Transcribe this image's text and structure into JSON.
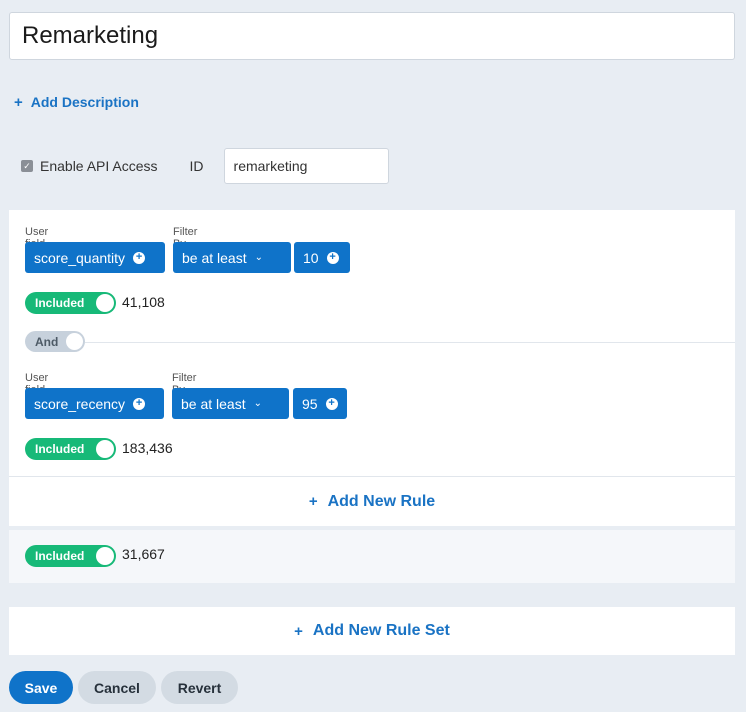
{
  "segment": {
    "name": "Remarketing"
  },
  "add_description": {
    "icon": "plus-icon",
    "label": "Add Description"
  },
  "api": {
    "checkbox_checked": true,
    "label": "Enable API Access",
    "id_label": "ID",
    "id_value": "remarketing"
  },
  "ruleset": {
    "rules": [
      {
        "user_field_label": "User field",
        "filter_label": "Filter By",
        "field": "score_quantity",
        "operator": "be at least",
        "value": "10",
        "toggle_label": "Included",
        "count": "41,108"
      },
      {
        "user_field_label": "User field",
        "filter_label": "Filter By",
        "field": "score_recency",
        "operator": "be at least",
        "value": "95",
        "toggle_label": "Included",
        "count": "183,436"
      }
    ],
    "combinator": "And",
    "add_rule_label": "Add New Rule"
  },
  "summary": {
    "toggle_label": "Included",
    "count": "31,667"
  },
  "add_ruleset_label": "Add New Rule Set",
  "actions": {
    "save": "Save",
    "cancel": "Cancel",
    "revert": "Revert"
  },
  "colors": {
    "primary": "#0f73c9",
    "included": "#17b978",
    "background": "#e8edf3"
  }
}
